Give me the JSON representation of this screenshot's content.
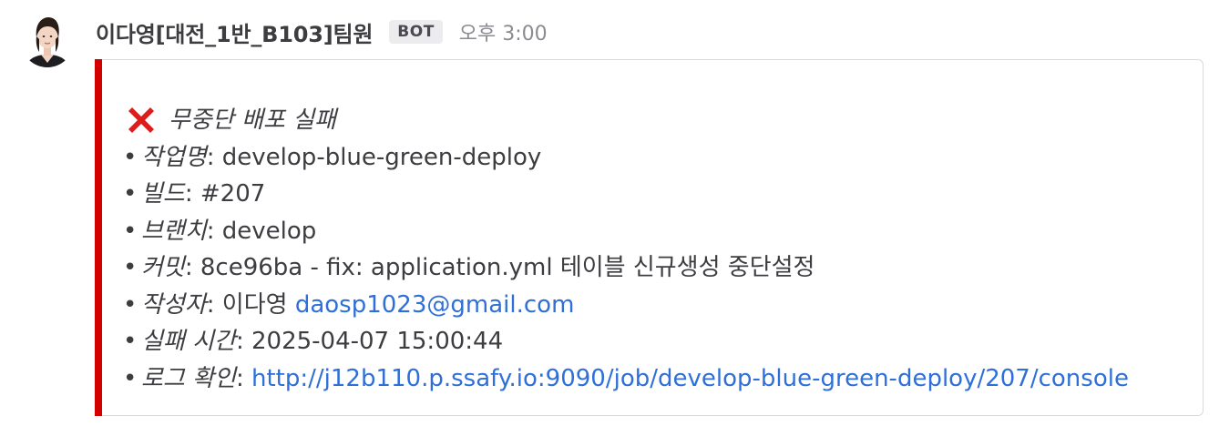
{
  "post": {
    "username": "이다영[대전_1반_B103]팀원",
    "badge": "BOT",
    "time": "오후 3:00"
  },
  "colors": {
    "accent_bar": "#d30000",
    "link": "#2f6fd8"
  },
  "attachment": {
    "icon": "x-mark-icon",
    "title": "무중단 배포 실패",
    "bullet": "•",
    "fields": {
      "job": {
        "label": "작업명",
        "sep": ":",
        "value": " develop-blue-green-deploy"
      },
      "build": {
        "label": "빌드",
        "sep": ":",
        "value": " #207"
      },
      "branch": {
        "label": "브랜치",
        "sep": ":",
        "value": " develop"
      },
      "commit": {
        "label": "커밋",
        "sep": ":",
        "value": " 8ce96ba - fix: application.yml 테이블 신규생성 중단설정"
      },
      "author": {
        "label": "작성자",
        "sep": ":",
        "value": " 이다영 ",
        "email": "daosp1023@gmail.com"
      },
      "failed_at": {
        "label": "실패 시간",
        "sep": ":",
        "value": " 2025-04-07 15:00:44"
      },
      "log": {
        "label": "로그 확인",
        "sep": ": ",
        "link": "http://j12b110.p.ssafy.io:9090/job/develop-blue-green-deploy/207/console"
      }
    }
  }
}
